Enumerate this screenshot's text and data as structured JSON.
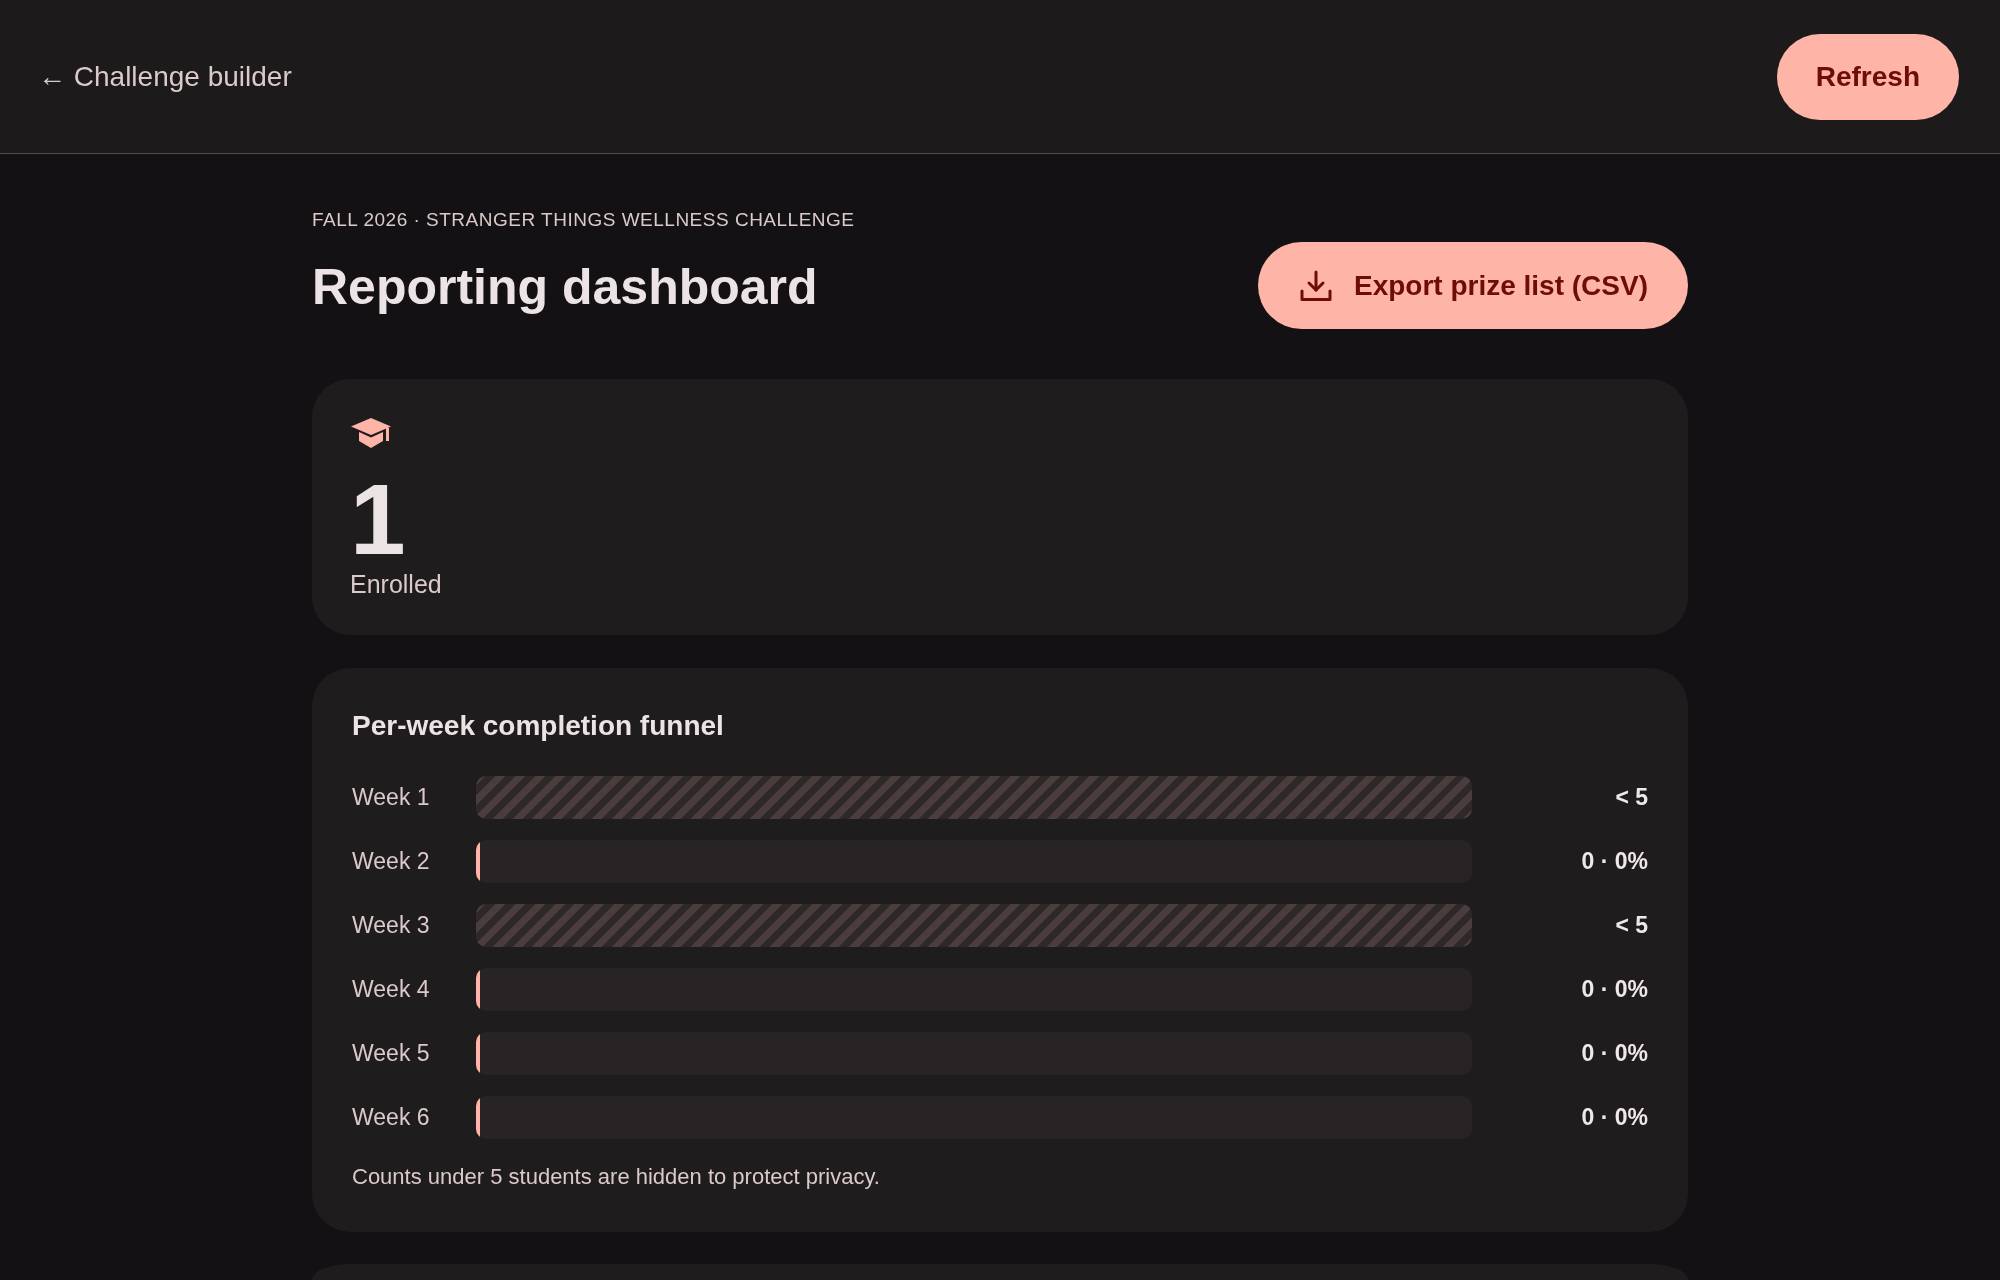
{
  "top_bar": {
    "back_link": "← Challenge builder",
    "refresh_button": "Refresh"
  },
  "header": {
    "eyebrow": "FALL 2026 · STRANGER THINGS WELLNESS CHALLENGE",
    "title": "Reporting dashboard",
    "export_button": "Export prize list (CSV)"
  },
  "stat_card": {
    "value": "1",
    "label": "Enrolled"
  },
  "funnel": {
    "title": "Per-week completion funnel",
    "rows": [
      {
        "label": "Week 1",
        "kind": "suppressed",
        "reading": "< 5"
      },
      {
        "label": "Week 2",
        "kind": "count",
        "level": 0,
        "reading": "0 · 0%"
      },
      {
        "label": "Week 3",
        "kind": "suppressed",
        "reading": "< 5"
      },
      {
        "label": "Week 4",
        "kind": "count",
        "level": 0,
        "reading": "0 · 0%"
      },
      {
        "label": "Week 5",
        "kind": "count",
        "level": 0,
        "reading": "0 · 0%"
      },
      {
        "label": "Week 6",
        "kind": "count",
        "level": 0,
        "reading": "0 · 0%"
      }
    ],
    "note": "Counts under 5 students are hidden to protect privacy."
  }
}
